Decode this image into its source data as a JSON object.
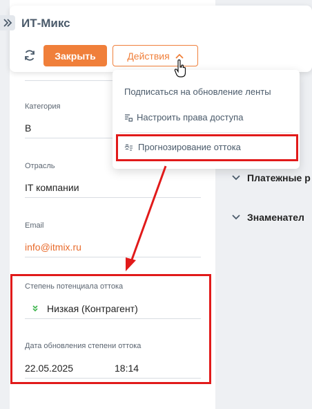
{
  "header": {
    "title": "ИТ-Микс",
    "close_label": "Закрыть",
    "actions_label": "Действия"
  },
  "dropdown": {
    "items": [
      {
        "label": "Подписаться на обновление ленты",
        "icon": "none"
      },
      {
        "label": "Настроить права доступа",
        "icon": "access-rights-icon"
      },
      {
        "label": "Прогнозирование оттока",
        "icon": "churn-forecast-icon"
      }
    ]
  },
  "fields": {
    "category": {
      "label": "Категория",
      "value": "B"
    },
    "industry": {
      "label": "Отрасль",
      "value": "IT компании"
    },
    "email": {
      "label": "Email",
      "value": "info@itmix.ru"
    },
    "churn_potential": {
      "label": "Степень потенциала оттока",
      "value": "Низкая (Контрагент)"
    },
    "churn_update": {
      "label": "Дата обновления степени оттока",
      "date": "22.05.2025",
      "time": "18:14"
    }
  },
  "sections": [
    {
      "label": "Платежные р"
    },
    {
      "label": "Знаменател"
    }
  ],
  "colors": {
    "accent": "#f07f3a",
    "highlight": "#e11a1a",
    "low_level": "#3cb44b"
  }
}
